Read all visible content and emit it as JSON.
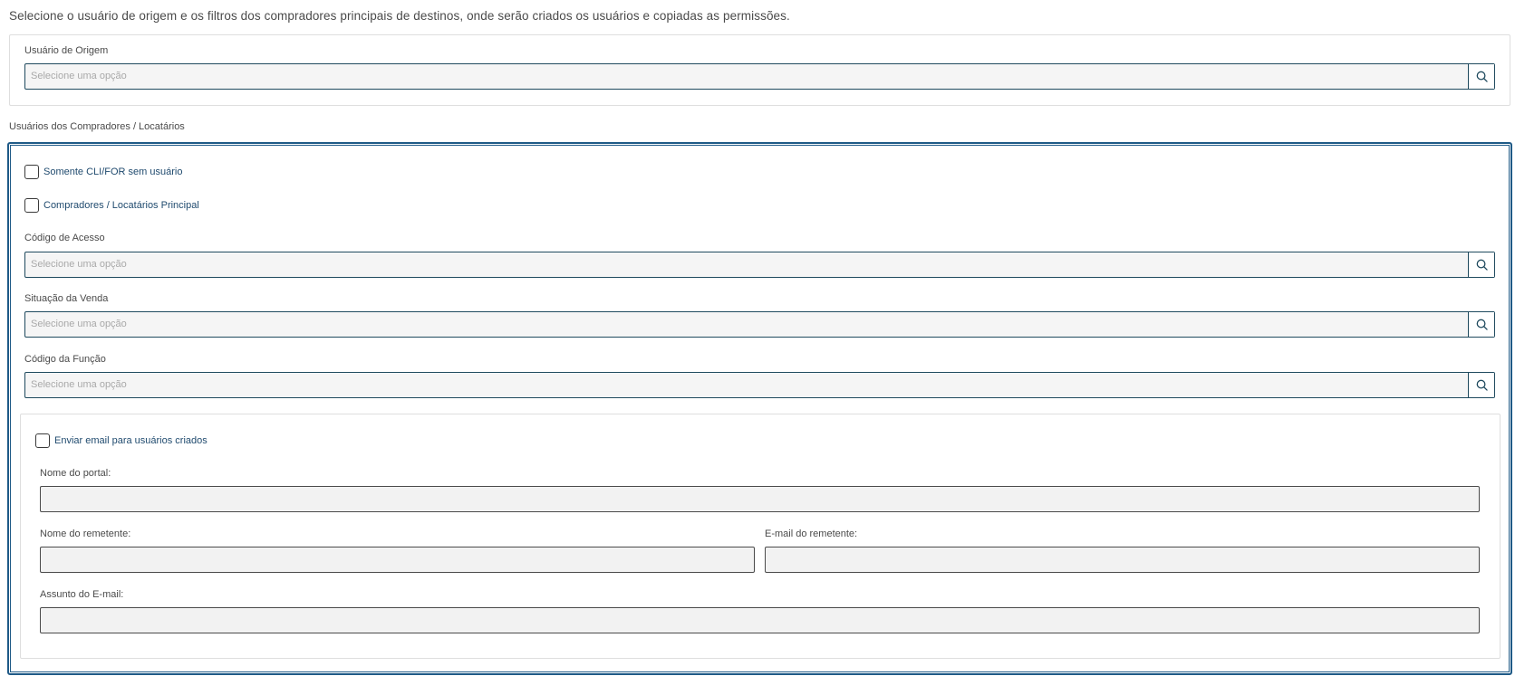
{
  "intro_text": "Selecione o usuário de origem e os filtros dos compradores principais de destinos, onde serão criados os usuários e copiadas as permissões.",
  "origin": {
    "label": "Usuário de Origem",
    "placeholder": "Selecione uma opção",
    "icon": "search-icon"
  },
  "buyers": {
    "title": "Usuários dos Compradores / Locatários",
    "only_without_user": "Somente CLI/FOR sem usuário",
    "main_buyers": "Compradores / Locatários Principal",
    "access_code": {
      "label": "Código de Acesso",
      "placeholder": "Selecione uma opção"
    },
    "sale_status": {
      "label": "Situação da Venda",
      "placeholder": "Selecione uma opção"
    },
    "function_code": {
      "label": "Código da Função",
      "placeholder": "Selecione uma opção"
    }
  },
  "email": {
    "send_email": "Enviar email para usuários criados",
    "portal_name_label": "Nome do portal:",
    "sender_name_label": "Nome do remetente:",
    "sender_email_label": "E-mail do remetente:",
    "subject_label": "Assunto do E-mail:",
    "portal_name_value": "",
    "sender_name_value": "",
    "sender_email_value": "",
    "subject_value": ""
  },
  "colors": {
    "accent": "#1f5a87",
    "field_border": "#1f4a5e",
    "checkbox_label": "#1f4a6e"
  }
}
